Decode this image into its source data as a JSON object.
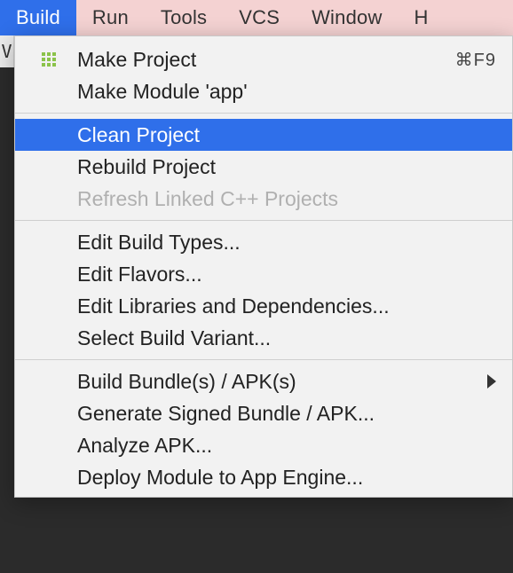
{
  "menubar": {
    "items": [
      {
        "label": "Build",
        "active": true
      },
      {
        "label": "Run",
        "active": false
      },
      {
        "label": "Tools",
        "active": false
      },
      {
        "label": "VCS",
        "active": false
      },
      {
        "label": "Window",
        "active": false
      },
      {
        "label": "H",
        "active": false
      }
    ]
  },
  "dropdown": {
    "groups": [
      [
        {
          "label": "Make Project",
          "shortcut": "⌘F9",
          "icon": "grid-icon",
          "disabled": false,
          "submenu": false,
          "highlighted": false
        },
        {
          "label": "Make Module 'app'",
          "shortcut": "",
          "icon": "",
          "disabled": false,
          "submenu": false,
          "highlighted": false
        }
      ],
      [
        {
          "label": "Clean Project",
          "shortcut": "",
          "icon": "",
          "disabled": false,
          "submenu": false,
          "highlighted": true
        },
        {
          "label": "Rebuild Project",
          "shortcut": "",
          "icon": "",
          "disabled": false,
          "submenu": false,
          "highlighted": false
        },
        {
          "label": "Refresh Linked C++ Projects",
          "shortcut": "",
          "icon": "",
          "disabled": true,
          "submenu": false,
          "highlighted": false
        }
      ],
      [
        {
          "label": "Edit Build Types...",
          "shortcut": "",
          "icon": "",
          "disabled": false,
          "submenu": false,
          "highlighted": false
        },
        {
          "label": "Edit Flavors...",
          "shortcut": "",
          "icon": "",
          "disabled": false,
          "submenu": false,
          "highlighted": false
        },
        {
          "label": "Edit Libraries and Dependencies...",
          "shortcut": "",
          "icon": "",
          "disabled": false,
          "submenu": false,
          "highlighted": false
        },
        {
          "label": "Select Build Variant...",
          "shortcut": "",
          "icon": "",
          "disabled": false,
          "submenu": false,
          "highlighted": false
        }
      ],
      [
        {
          "label": "Build Bundle(s) / APK(s)",
          "shortcut": "",
          "icon": "",
          "disabled": false,
          "submenu": true,
          "highlighted": false
        },
        {
          "label": "Generate Signed Bundle / APK...",
          "shortcut": "",
          "icon": "",
          "disabled": false,
          "submenu": false,
          "highlighted": false
        },
        {
          "label": "Analyze APK...",
          "shortcut": "",
          "icon": "",
          "disabled": false,
          "submenu": false,
          "highlighted": false
        },
        {
          "label": "Deploy Module to App Engine...",
          "shortcut": "",
          "icon": "",
          "disabled": false,
          "submenu": false,
          "highlighted": false
        }
      ]
    ]
  },
  "toolbar_strip": "V"
}
